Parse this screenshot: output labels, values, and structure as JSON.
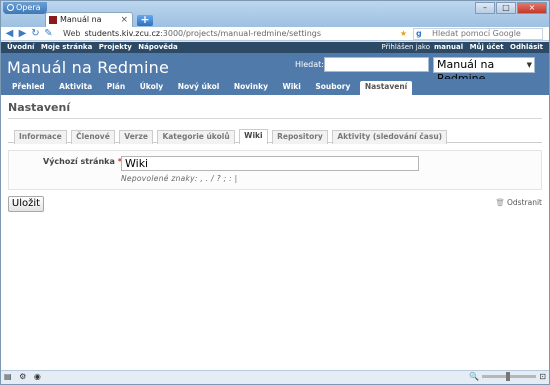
{
  "browser": {
    "app_name": "Opera",
    "tab_title": "Manuál na Redmi...",
    "tab_close": "×",
    "new_tab": "+",
    "window_controls": {
      "minimize": "–",
      "maximize": "□",
      "close": "×"
    },
    "address": {
      "prefix": "Web",
      "host": "students.kiv.zcu.cz",
      "path": ":3000/projects/manual-redmine/settings"
    },
    "search_placeholder": "Hledat pomocí Google"
  },
  "top_menu": {
    "items": [
      "Úvodní",
      "Moje stránka",
      "Projekty",
      "Nápověda"
    ],
    "login_text": "Přihlášen jako",
    "user": "manual",
    "account": "Můj účet",
    "logout": "Odhlásit"
  },
  "header": {
    "project_title": "Manuál na Redmine",
    "search_label": "Hledat:",
    "project_select": "Manuál na Redmine",
    "select_arrow": "▼"
  },
  "main_menu": {
    "items": [
      "Přehled",
      "Aktivita",
      "Plán",
      "Úkoly",
      "Nový úkol",
      "Novinky",
      "Wiki",
      "Soubory",
      "Nastavení"
    ],
    "selected": "Nastavení"
  },
  "settings": {
    "heading": "Nastavení",
    "tabs": [
      "Informace",
      "Členové",
      "Verze",
      "Kategorie úkolů",
      "Wiki",
      "Repository",
      "Aktivity (sledování času)"
    ],
    "selected_tab": "Wiki",
    "start_page_label": "Výchozí stránka",
    "required_mark": "*",
    "start_page_value": "Wiki",
    "hint": "Nepovolené znaky: , . / ? ; : |",
    "save_label": "Uložit",
    "delete_label": "Odstranit"
  },
  "icons": [
    "opera-logo-icon",
    "back-icon",
    "forward-icon",
    "reload-icon",
    "edit-icon",
    "star-icon",
    "google-icon",
    "trash-icon",
    "zoom-icon"
  ]
}
